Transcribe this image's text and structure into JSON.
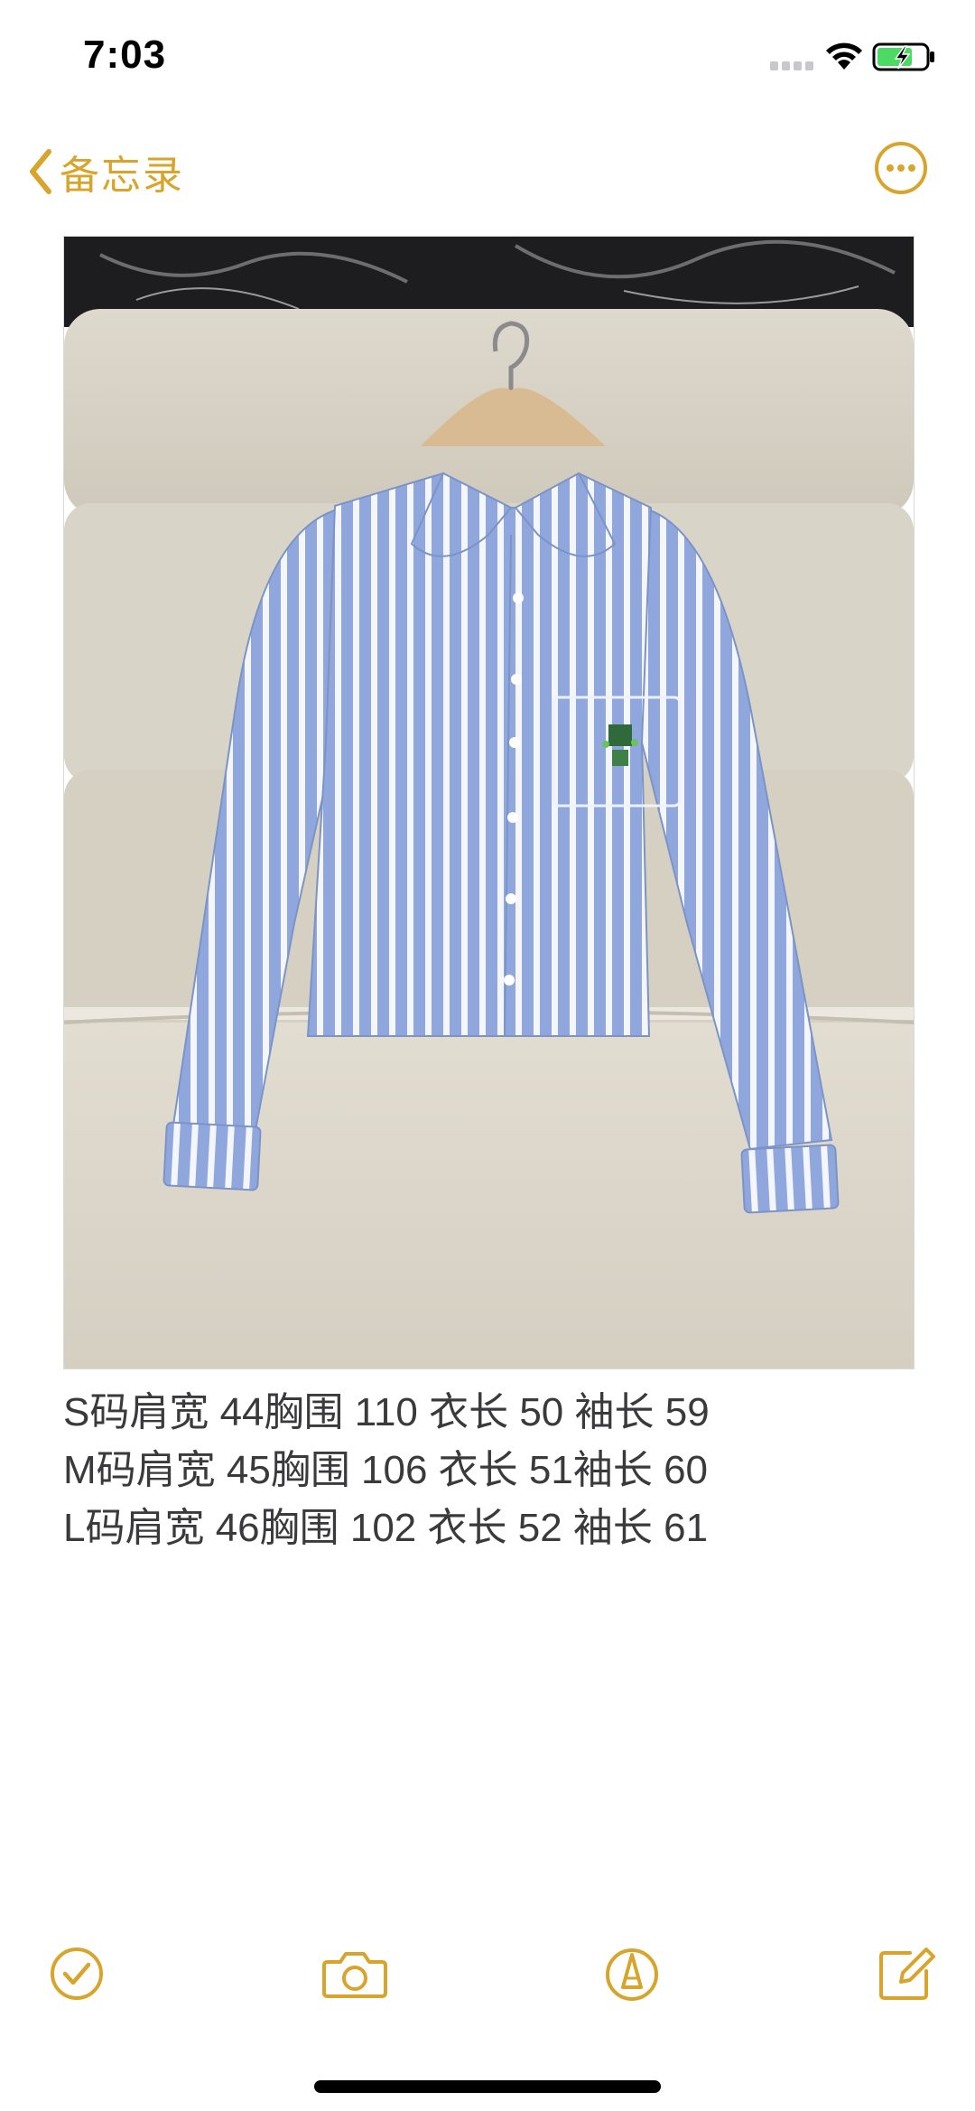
{
  "status_bar": {
    "time": "7:03",
    "signal_icon": "cellular-signal-icon",
    "wifi_icon": "wifi-icon",
    "battery_icon": "battery-charging-icon",
    "battery_color": "#4cd964"
  },
  "nav": {
    "back_label": "备忘录",
    "back_icon": "chevron-left-icon",
    "more_icon": "ellipsis-circle-icon",
    "accent_color": "#d7a52c"
  },
  "note": {
    "image": {
      "subject": "photo-striped-shirt",
      "shirt_color": "#8fa7dc",
      "stripe_color": "#ffffff"
    },
    "lines": [
      "S码肩宽 44胸围 110 衣长 50 袖长 59",
      "M码肩宽 45胸围 106 衣长 51袖长 60",
      "L码肩宽 46胸围 102 衣长 52 袖长 61"
    ]
  },
  "toolbar": {
    "checklist_icon": "checklist-circle-icon",
    "camera_icon": "camera-icon",
    "markup_icon": "markup-pen-icon",
    "compose_icon": "compose-icon"
  }
}
